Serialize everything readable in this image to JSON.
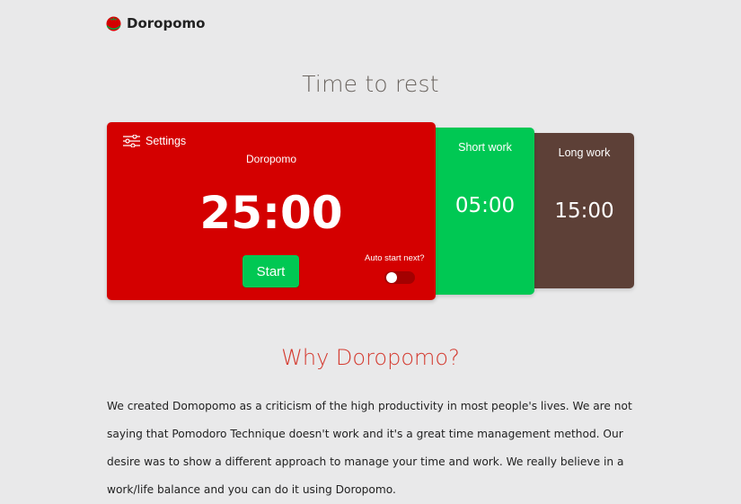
{
  "header": {
    "brand": "Doropomo",
    "logo_icon": "tomato-icon"
  },
  "hero": {
    "title": "Time to rest"
  },
  "timer": {
    "settings_label": "Settings",
    "settings_icon": "sliders-icon",
    "mode_label": "Doropomo",
    "time": "25:00",
    "start_label": "Start",
    "auto_start_label": "Auto start next?",
    "auto_start_enabled": false,
    "color": "#d40000"
  },
  "short_work": {
    "label": "Short work",
    "time": "05:00",
    "color": "#00c853"
  },
  "long_work": {
    "label": "Long work",
    "time": "15:00",
    "color": "#5d4037"
  },
  "why": {
    "title": "Why Doropomo?",
    "title_color": "#d43a2f",
    "text": "We created Domopomo as a criticism of the high productivity in most people's lives. We are not saying that Pomodoro Technique doesn't work and it's a great time management method. Our desire was to show a different approach to manage your time and work. We really believe in a work/life balance and you can do it using Doropomo."
  }
}
